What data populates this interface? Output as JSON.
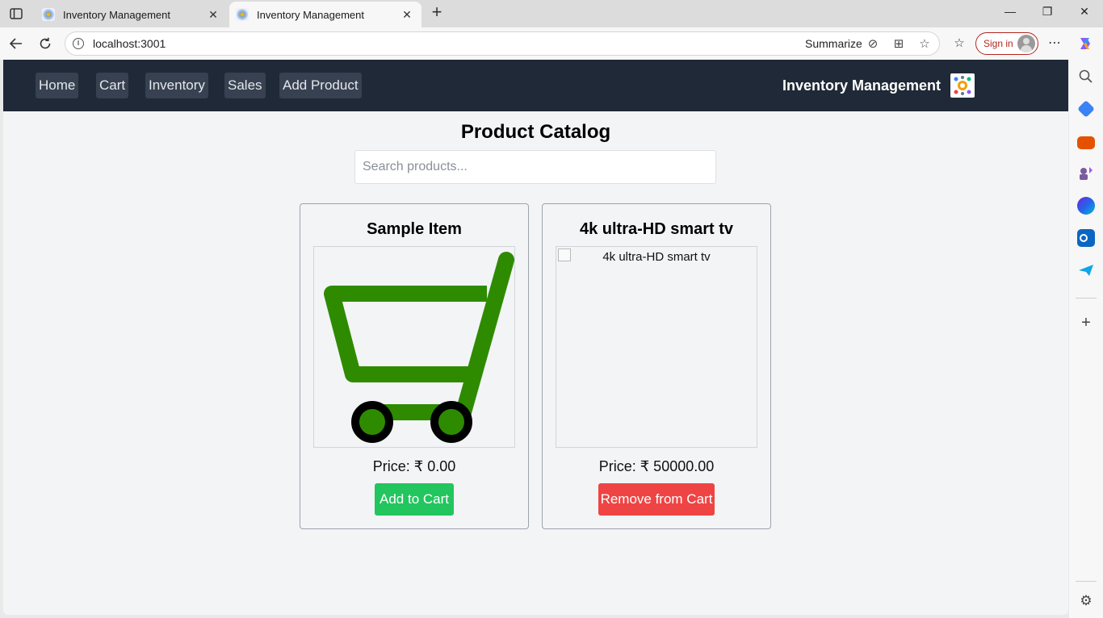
{
  "browser": {
    "tabs": [
      {
        "title": "Inventory Management",
        "active": false
      },
      {
        "title": "Inventory Management",
        "active": true
      }
    ],
    "url": "localhost:3001",
    "summarize_label": "Summarize",
    "sign_in_label": "Sign in"
  },
  "app": {
    "nav": [
      {
        "label": "Home"
      },
      {
        "label": "Cart"
      },
      {
        "label": "Inventory"
      },
      {
        "label": "Sales"
      },
      {
        "label": "Add Product"
      }
    ],
    "brand": "Inventory Management",
    "page_title": "Product Catalog",
    "search_placeholder": "Search products...",
    "products": [
      {
        "name": "Sample Item",
        "price": "Price: ₹ 0.00",
        "action": "Add to Cart",
        "action_color": "#22c55e",
        "image": "shopping-cart-icon"
      },
      {
        "name": "4k ultra-HD smart tv",
        "price": "Price: ₹ 50000.00",
        "action": "Remove from Cart",
        "action_color": "#ef4444",
        "image_alt": "4k ultra-HD smart tv"
      }
    ]
  },
  "colors": {
    "nav_bg": "#1f2937",
    "nav_link_bg": "#374151",
    "page_bg": "#f3f4f6",
    "cart_green": "#2e8b00"
  }
}
